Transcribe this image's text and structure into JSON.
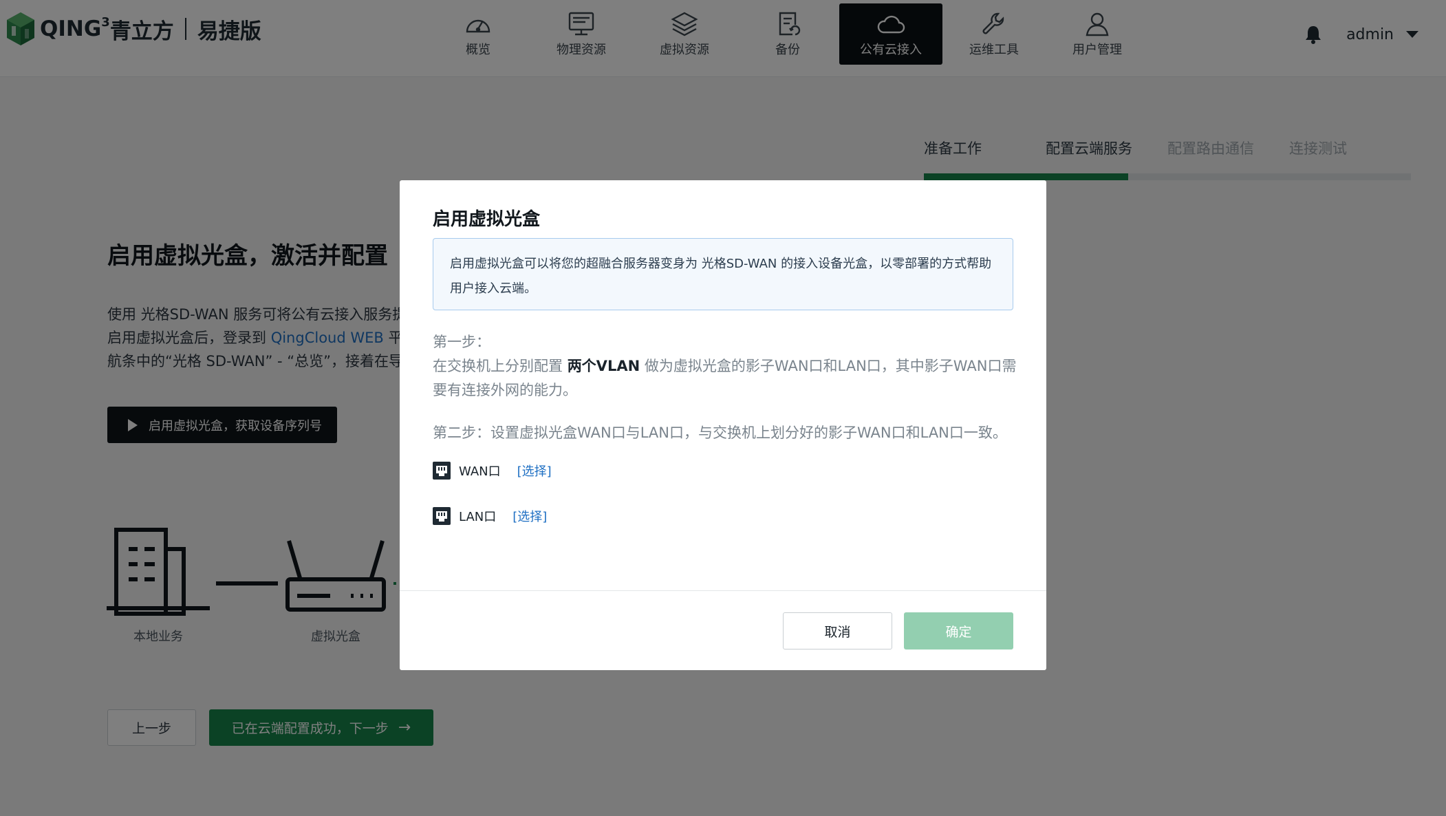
{
  "header": {
    "logo": {
      "brand": "QING",
      "superscript": "3",
      "cn_name": "青立方",
      "edition": "易捷版"
    },
    "nav": [
      {
        "label": "概览",
        "icon": "dashboard-icon",
        "active": false
      },
      {
        "label": "物理资源",
        "icon": "monitor-icon",
        "active": false
      },
      {
        "label": "虚拟资源",
        "icon": "layers-icon",
        "active": false
      },
      {
        "label": "备份",
        "icon": "backup-document-icon",
        "active": false
      },
      {
        "label": "公有云接入",
        "icon": "cloud-icon",
        "active": true
      },
      {
        "label": "运维工具",
        "icon": "wrench-icon",
        "active": false
      },
      {
        "label": "用户管理",
        "icon": "user-icon",
        "active": false
      }
    ],
    "user": "admin"
  },
  "steps": {
    "items": [
      "准备工作",
      "配置云端服务",
      "配置路由通信",
      "连接测试"
    ],
    "current_index": 1,
    "progress_fraction": 0.42
  },
  "background": {
    "title": "启用虚拟光盒，激活并配置",
    "desc_line1": "使用 光格SD-WAN 服务可将公有云接入服务提",
    "desc_line2_prefix": "启用虚拟光盒后，登录到",
    "desc_line2_link": "QingCloud WEB",
    "desc_line2_suffix": "平台",
    "desc_line3": "航条中的“光格 SD-WAN” - “总览”，接着在导航",
    "start_button": "启用虚拟光盒，获取设备序列号",
    "diagram_labels": {
      "local": "本地业务",
      "box": "虚拟光盒"
    },
    "prev_button": "上一步",
    "next_button": "已在云端配置成功，下一步"
  },
  "modal": {
    "title": "启用虚拟光盒",
    "info_line1": "启用虚拟光盒可以将您的超融合服务器变身为 光格SD-WAN 的接入设备光盒，以零部署的方式帮助",
    "info_line2": "用户接入云端。",
    "step1_label": "第一步：",
    "step1_prefix": "在交换机上分别配置",
    "step1_bold": "两个VLAN",
    "step1_suffix": "做为虚拟光盒的影子WAN口和LAN口，其中影子WAN口需",
    "step1_line3": "要有连接外网的能力。",
    "step2": "第二步：设置虚拟光盒WAN口与LAN口，与交换机上划分好的影子WAN口和LAN口一致。",
    "ports": [
      {
        "name": "WAN口",
        "select": "[选择]"
      },
      {
        "name": "LAN口",
        "select": "[选择]"
      }
    ],
    "cancel": "取消",
    "confirm": "确定"
  },
  "colors": {
    "brand_green": "#16854a",
    "link_blue": "#1e6fc3",
    "nav_active": "#0b1114",
    "confirm_disabled": "#93cfb0"
  }
}
